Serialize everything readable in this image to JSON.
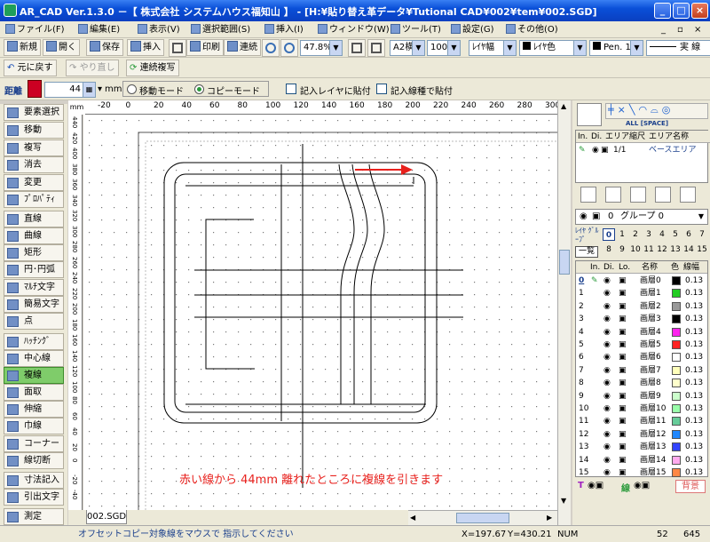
{
  "window": {
    "title": "AR_CAD Ver.1.3.0 －【 株式会社 システムハウス福知山 】 - [H:¥貼り替え革データ¥Tutional CAD¥002¥tem¥002.SGD]",
    "minimize": "_",
    "maximize": "□",
    "close": "×"
  },
  "menu": [
    "ファイル(F)",
    "編集(E)",
    "表示(V)",
    "選択範囲(S)",
    "挿入(I)",
    "ウィンドウ(W)",
    "ツール(T)",
    "設定(G)",
    "その他(O)"
  ],
  "menu_right": {
    "min": "_",
    "restore": "▫",
    "close": "×"
  },
  "toolbar1": {
    "new": "新規",
    "open": "開く",
    "save": "保存",
    "insert": "挿入",
    "print": "印刷",
    "link": "連続",
    "zoom": "47.8%",
    "paper": "A2横",
    "scale": "100",
    "layer_width": "ﾚｲﾔ幅",
    "layer_color": "ﾚｲﾔ色",
    "pen": "Pen. 1",
    "line_style": "実 線"
  },
  "toolbar2": {
    "undo": "元に戻す",
    "redo": "やり直し",
    "continuous": "連続複写"
  },
  "toolbar3": {
    "distance_label": "距離",
    "distance_value": "44",
    "unit": "mm",
    "mode_move": "移動モード",
    "mode_copy": "コピーモード",
    "opt_layer": "記入レイヤに貼付",
    "opt_linetype": "記入線種で貼付"
  },
  "tools": [
    "要素選択",
    "移動",
    "複写",
    "消去",
    "変更",
    "ﾌﾟﾛﾊﾟﾃｨ",
    "直線",
    "曲線",
    "矩形",
    "円･円弧",
    "ﾏﾙﾁ文字",
    "簡易文字",
    "点",
    "ﾊｯﾁﾝｸﾞ",
    "中心線",
    "複線",
    "面取",
    "伸縮",
    "巾線",
    "コーナー",
    "線切断",
    "寸法記入",
    "引出文字",
    "測定"
  ],
  "active_tool": "複線",
  "ruler": {
    "unit": "mm",
    "top_ticks": [
      "-20",
      "0",
      "20",
      "40",
      "60",
      "80",
      "100",
      "120",
      "140",
      "160",
      "180",
      "200",
      "220",
      "240",
      "260",
      "280",
      "300"
    ],
    "left_ticks": [
      "440",
      "420",
      "400",
      "380",
      "360",
      "340",
      "320",
      "300",
      "280",
      "260",
      "240",
      "220",
      "200",
      "180",
      "160",
      "140",
      "120",
      "100",
      "80",
      "60",
      "40",
      "20",
      "0",
      "-20",
      "-40"
    ]
  },
  "canvas": {
    "annotation": "赤い線から 44mm 離れたところに複線を引きます",
    "annotation_color": "#e8201c",
    "arrow_color": "#e8201c"
  },
  "doc_tab": "002.SGD",
  "right": {
    "icons_label": "ALL [SPACE]",
    "area_headers": [
      "In.",
      "Di.",
      "エリア縮尺",
      "エリア名称"
    ],
    "area_row": {
      "scale": "1/1",
      "name": "ベースエリア"
    },
    "group": {
      "num": "0",
      "label": "グループ 0"
    },
    "layer_group_label": "ﾚｲﾔ ｸﾞﾙｰﾌﾟ",
    "group_nums_row1": [
      "0",
      "1",
      "2",
      "3",
      "4",
      "5",
      "6",
      "7"
    ],
    "group_nums_row2": [
      "8",
      "9",
      "10",
      "11",
      "12",
      "13",
      "14",
      "15"
    ],
    "list_btn": "一覧",
    "layer_headers": [
      "In.",
      "Di.",
      "Lo.",
      "名称",
      "色",
      "線幅"
    ],
    "layers": [
      {
        "no": "0",
        "name": "画層0",
        "color": "#000000",
        "width": "0.13"
      },
      {
        "no": "1",
        "name": "画層1",
        "color": "#22cc22",
        "width": "0.13"
      },
      {
        "no": "2",
        "name": "画層2",
        "color": "#999999",
        "width": "0.13"
      },
      {
        "no": "3",
        "name": "画層3",
        "color": "#000000",
        "width": "0.13"
      },
      {
        "no": "4",
        "name": "画層4",
        "color": "#ff22ee",
        "width": "0.13"
      },
      {
        "no": "5",
        "name": "画層5",
        "color": "#ff2222",
        "width": "0.13"
      },
      {
        "no": "6",
        "name": "画層6",
        "color": "#ffffff",
        "width": "0.13"
      },
      {
        "no": "7",
        "name": "画層7",
        "color": "#ffffbb",
        "width": "0.13"
      },
      {
        "no": "8",
        "name": "画層8",
        "color": "#ffffcc",
        "width": "0.13"
      },
      {
        "no": "9",
        "name": "画層9",
        "color": "#ccffcc",
        "width": "0.13"
      },
      {
        "no": "10",
        "name": "画層10",
        "color": "#99ffaa",
        "width": "0.13"
      },
      {
        "no": "11",
        "name": "画層11",
        "color": "#66cc99",
        "width": "0.13"
      },
      {
        "no": "12",
        "name": "画層12",
        "color": "#2288ff",
        "width": "0.13"
      },
      {
        "no": "13",
        "name": "画層13",
        "color": "#3344ff",
        "width": "0.13"
      },
      {
        "no": "14",
        "name": "画層14",
        "color": "#ffaaee",
        "width": "0.13"
      },
      {
        "no": "15",
        "name": "画層15",
        "color": "#ff8844",
        "width": "0.13"
      }
    ],
    "bottom": {
      "t": "T",
      "line": "線",
      "bg": "背景"
    }
  },
  "status": {
    "message": "オフセットコピー対象線をマウスで 指示してください",
    "x": "X=197.67",
    "y": "Y=430.21",
    "num": "NUM",
    "v1": "52",
    "v2": "645"
  }
}
